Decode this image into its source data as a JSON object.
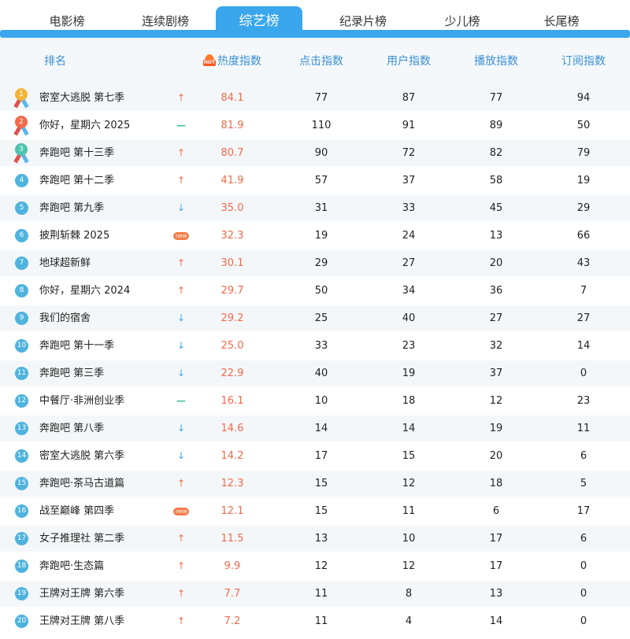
{
  "tabs": [
    {
      "label": "电影榜",
      "active": false
    },
    {
      "label": "连续剧榜",
      "active": false
    },
    {
      "label": "综艺榜",
      "active": true
    },
    {
      "label": "纪录片榜",
      "active": false
    },
    {
      "label": "少儿榜",
      "active": false
    },
    {
      "label": "长尾榜",
      "active": false
    }
  ],
  "header": {
    "rank": "排名",
    "hot_badge": "HOT",
    "heat": "热度指数",
    "click": "点击指数",
    "user": "用户指数",
    "play": "播放指数",
    "subscribe": "订阅指数"
  },
  "colors": {
    "accent": "#3aa6ec",
    "heat": "#f06a4b",
    "gold": "#f2b53a",
    "red": "#f06a4b",
    "teal": "#4fc3b0"
  },
  "rows": [
    {
      "rank": "1",
      "name": "密室大逃脱 第七季",
      "trend": "up",
      "heat": "84.1",
      "click": "77",
      "user": "87",
      "play": "77",
      "subscribe": "94"
    },
    {
      "rank": "2",
      "name": "你好，星期六 2025",
      "trend": "flat",
      "heat": "81.9",
      "click": "110",
      "user": "91",
      "play": "89",
      "subscribe": "50"
    },
    {
      "rank": "3",
      "name": "奔跑吧 第十三季",
      "trend": "up",
      "heat": "80.7",
      "click": "90",
      "user": "72",
      "play": "82",
      "subscribe": "79"
    },
    {
      "rank": "4",
      "name": "奔跑吧 第十二季",
      "trend": "up",
      "heat": "41.9",
      "click": "57",
      "user": "37",
      "play": "58",
      "subscribe": "19"
    },
    {
      "rank": "5",
      "name": "奔跑吧 第九季",
      "trend": "down",
      "heat": "35.0",
      "click": "31",
      "user": "33",
      "play": "45",
      "subscribe": "29"
    },
    {
      "rank": "6",
      "name": "披荆斩棘 2025",
      "trend": "new",
      "heat": "32.3",
      "click": "19",
      "user": "24",
      "play": "13",
      "subscribe": "66"
    },
    {
      "rank": "7",
      "name": "地球超新鲜",
      "trend": "up",
      "heat": "30.1",
      "click": "29",
      "user": "27",
      "play": "20",
      "subscribe": "43"
    },
    {
      "rank": "8",
      "name": "你好，星期六 2024",
      "trend": "up",
      "heat": "29.7",
      "click": "50",
      "user": "34",
      "play": "36",
      "subscribe": "7"
    },
    {
      "rank": "9",
      "name": "我们的宿舍",
      "trend": "down",
      "heat": "29.2",
      "click": "25",
      "user": "40",
      "play": "27",
      "subscribe": "27"
    },
    {
      "rank": "10",
      "name": "奔跑吧 第十一季",
      "trend": "down",
      "heat": "25.0",
      "click": "33",
      "user": "23",
      "play": "32",
      "subscribe": "14"
    },
    {
      "rank": "11",
      "name": "奔跑吧 第三季",
      "trend": "down",
      "heat": "22.9",
      "click": "40",
      "user": "19",
      "play": "37",
      "subscribe": "0"
    },
    {
      "rank": "12",
      "name": "中餐厅·非洲创业季",
      "trend": "flat",
      "heat": "16.1",
      "click": "10",
      "user": "18",
      "play": "12",
      "subscribe": "23"
    },
    {
      "rank": "13",
      "name": "奔跑吧 第八季",
      "trend": "down",
      "heat": "14.6",
      "click": "14",
      "user": "14",
      "play": "19",
      "subscribe": "11"
    },
    {
      "rank": "14",
      "name": "密室大逃脱 第六季",
      "trend": "down",
      "heat": "14.2",
      "click": "17",
      "user": "15",
      "play": "20",
      "subscribe": "6"
    },
    {
      "rank": "15",
      "name": "奔跑吧·茶马古道篇",
      "trend": "up",
      "heat": "12.3",
      "click": "15",
      "user": "12",
      "play": "18",
      "subscribe": "5"
    },
    {
      "rank": "16",
      "name": "战至巅峰 第四季",
      "trend": "new",
      "heat": "12.1",
      "click": "15",
      "user": "11",
      "play": "6",
      "subscribe": "17"
    },
    {
      "rank": "17",
      "name": "女子推理社 第二季",
      "trend": "up",
      "heat": "11.5",
      "click": "13",
      "user": "10",
      "play": "17",
      "subscribe": "6"
    },
    {
      "rank": "18",
      "name": "奔跑吧·生态篇",
      "trend": "up",
      "heat": "9.9",
      "click": "12",
      "user": "12",
      "play": "17",
      "subscribe": "0"
    },
    {
      "rank": "19",
      "name": "王牌对王牌 第六季",
      "trend": "up",
      "heat": "7.7",
      "click": "11",
      "user": "8",
      "play": "13",
      "subscribe": "0"
    },
    {
      "rank": "20",
      "name": "王牌对王牌 第八季",
      "trend": "up",
      "heat": "7.2",
      "click": "11",
      "user": "4",
      "play": "14",
      "subscribe": "0"
    }
  ],
  "trend_glyphs": {
    "up": "↑",
    "down": "↓",
    "flat": "—",
    "new": "new"
  }
}
